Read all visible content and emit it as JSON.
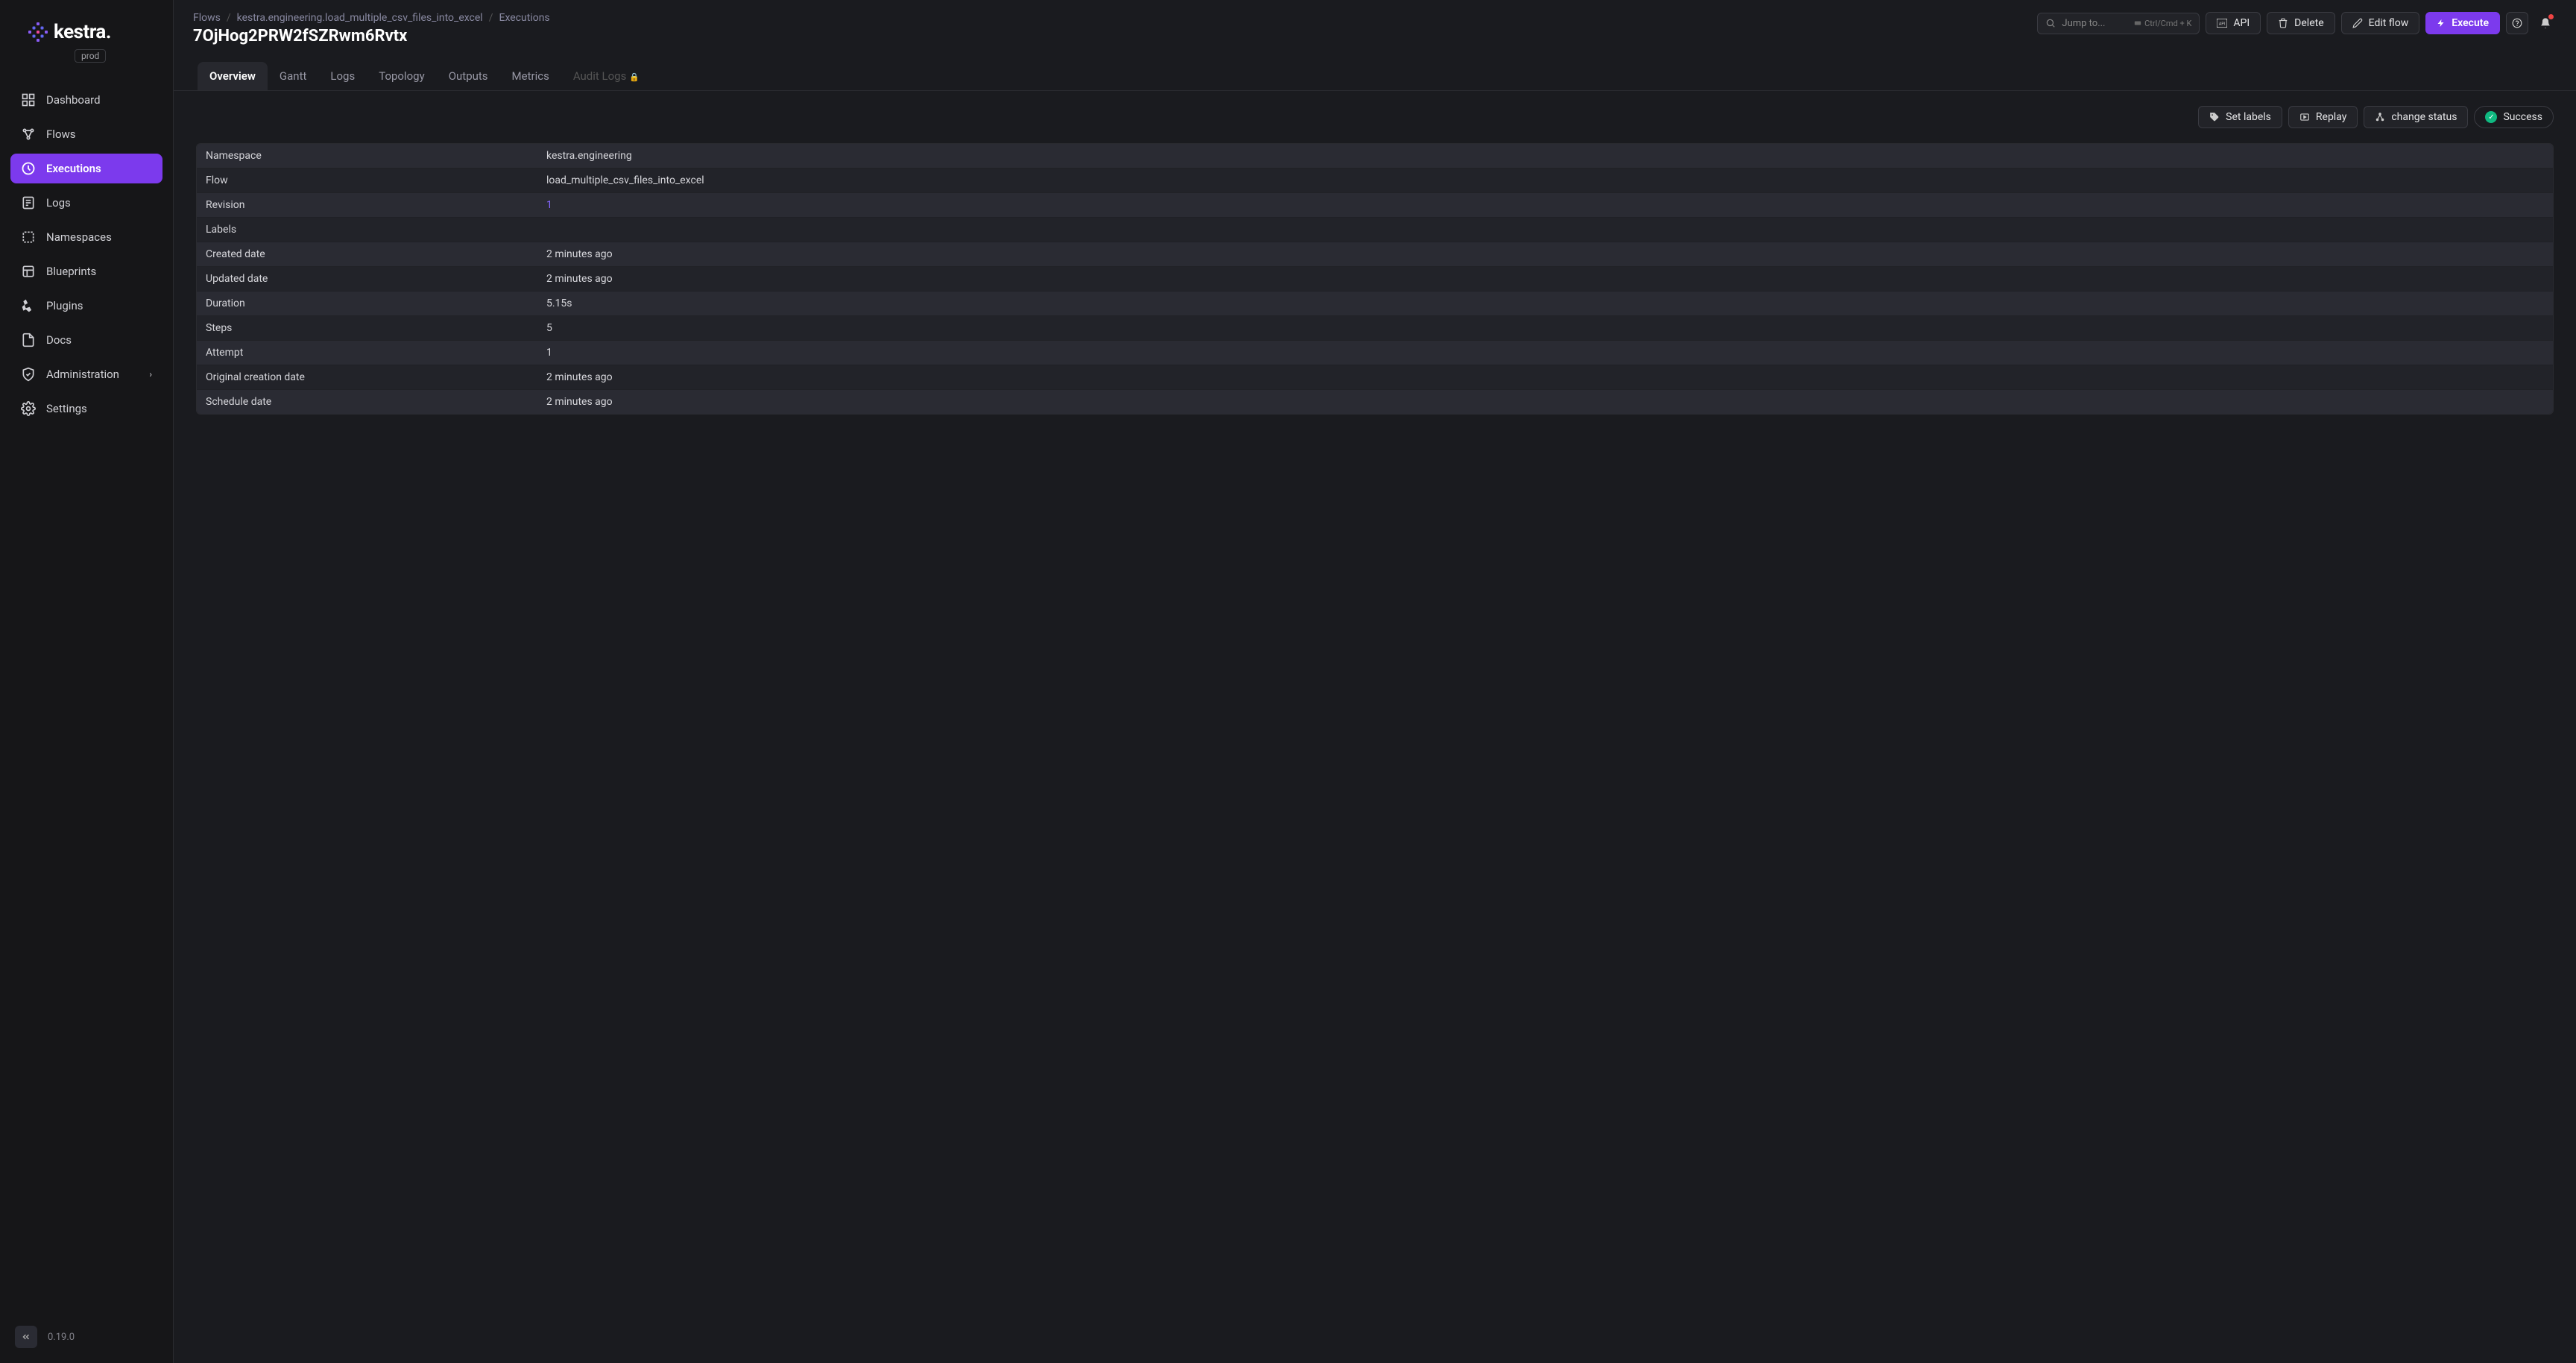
{
  "app": {
    "logo_text": "kestra.",
    "env": "prod",
    "version": "0.19.0"
  },
  "nav": [
    {
      "label": "Dashboard",
      "icon": "dashboard"
    },
    {
      "label": "Flows",
      "icon": "flows"
    },
    {
      "label": "Executions",
      "icon": "executions",
      "active": true
    },
    {
      "label": "Logs",
      "icon": "logs"
    },
    {
      "label": "Namespaces",
      "icon": "namespaces"
    },
    {
      "label": "Blueprints",
      "icon": "blueprints"
    },
    {
      "label": "Plugins",
      "icon": "plugins"
    },
    {
      "label": "Docs",
      "icon": "docs"
    },
    {
      "label": "Administration",
      "icon": "admin",
      "chevron": true
    },
    {
      "label": "Settings",
      "icon": "settings"
    }
  ],
  "breadcrumb": [
    "Flows",
    "kestra.engineering.load_multiple_csv_files_into_excel",
    "Executions"
  ],
  "page_title": "7OjHog2PRW2fSZRwm6Rvtx",
  "header": {
    "search_placeholder": "Jump to...",
    "search_kbd": "Ctrl/Cmd + K",
    "api_label": "API",
    "delete_label": "Delete",
    "edit_label": "Edit flow",
    "execute_label": "Execute"
  },
  "tabs": [
    {
      "label": "Overview",
      "active": true
    },
    {
      "label": "Gantt"
    },
    {
      "label": "Logs"
    },
    {
      "label": "Topology"
    },
    {
      "label": "Outputs"
    },
    {
      "label": "Metrics"
    },
    {
      "label": "Audit Logs",
      "disabled": true
    }
  ],
  "actions": {
    "set_labels": "Set labels",
    "replay": "Replay",
    "change_status": "change status",
    "status": "Success"
  },
  "details": [
    {
      "key": "Namespace",
      "value": "kestra.engineering"
    },
    {
      "key": "Flow",
      "value": "load_multiple_csv_files_into_excel"
    },
    {
      "key": "Revision",
      "value": "1",
      "link": true
    },
    {
      "key": "Labels",
      "value": ""
    },
    {
      "key": "Created date",
      "value": "2 minutes ago"
    },
    {
      "key": "Updated date",
      "value": "2 minutes ago"
    },
    {
      "key": "Duration",
      "value": "5.15s"
    },
    {
      "key": "Steps",
      "value": "5"
    },
    {
      "key": "Attempt",
      "value": "1"
    },
    {
      "key": "Original creation date",
      "value": "2 minutes ago"
    },
    {
      "key": "Schedule date",
      "value": "2 minutes ago"
    }
  ]
}
